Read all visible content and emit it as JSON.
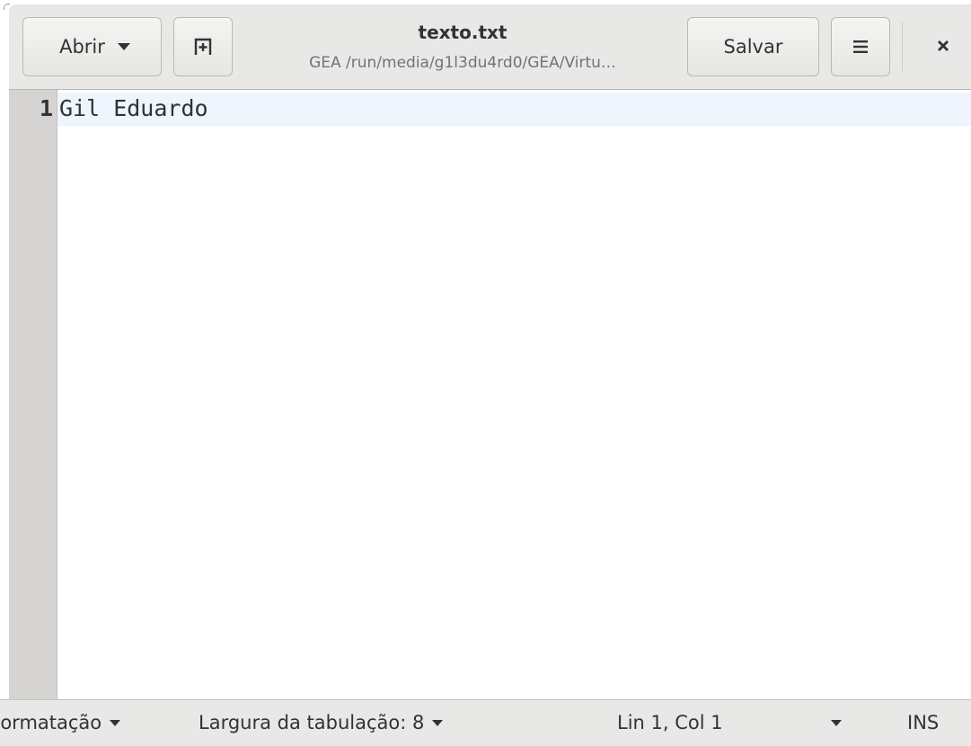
{
  "header": {
    "open_label": "Abrir",
    "title": "texto.txt",
    "subtitle": "GEA /run/media/g1l3du4rd0/GEA/Virtu…",
    "save_label": "Salvar",
    "new_tab_icon": "new-document-icon",
    "menu_icon": "hamburger-menu-icon",
    "close_icon": "close-icon"
  },
  "editor": {
    "line_numbers": [
      "1"
    ],
    "lines": [
      "Gil Eduardo"
    ]
  },
  "statusbar": {
    "format_label": "Formatação",
    "tab_width_label": "Largura da tabulação: 8",
    "cursor_position": "Lin 1, Col 1",
    "insert_mode": "INS"
  },
  "colors": {
    "header_bg": "#e8e8e7",
    "gutter_bg": "#d6d4d2",
    "current_line_bg": "#eef5fc"
  }
}
